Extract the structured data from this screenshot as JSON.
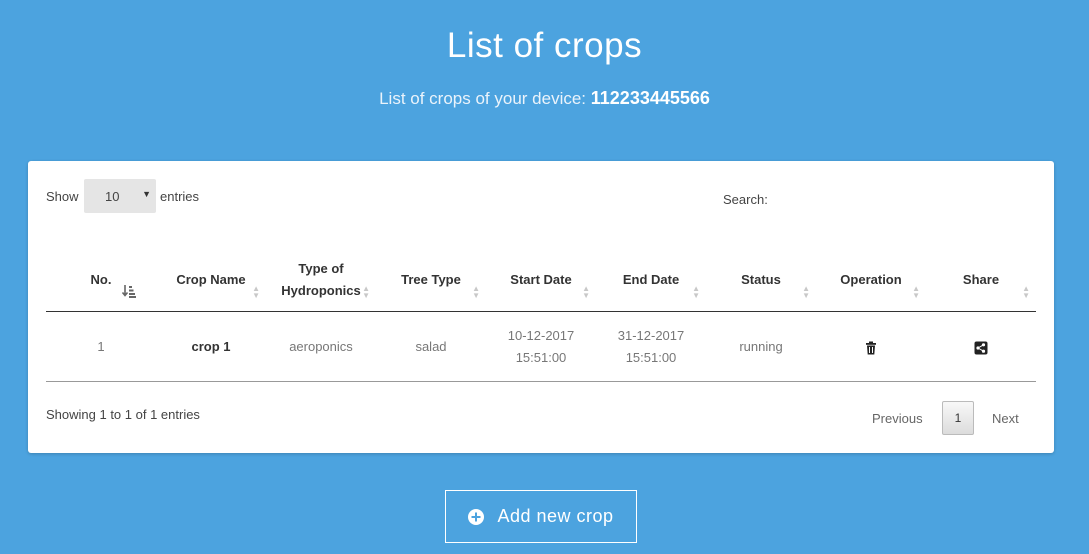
{
  "header": {
    "title": "List of crops",
    "subtitle_prefix": "List of crops of your device:",
    "device_id": "112233445566"
  },
  "controls": {
    "show_label": "Show",
    "entries_value": "10",
    "entries_label": "entries",
    "search_label": "Search:",
    "search_value": ""
  },
  "table": {
    "columns": [
      "No.",
      "Crop Name",
      "Type of Hydroponics",
      "Tree Type",
      "Start Date",
      "End Date",
      "Status",
      "Operation",
      "Share"
    ],
    "rows": [
      {
        "no": "1",
        "crop_name": "crop 1",
        "hydroponics_type": "aeroponics",
        "tree_type": "salad",
        "start_date": "10-12-2017 15:51:00",
        "end_date": "31-12-2017 15:51:00",
        "status": "running",
        "operation_icon": "trash-icon",
        "share_icon": "share-icon"
      }
    ]
  },
  "footer": {
    "showing_text": "Showing 1 to 1 of 1 entries",
    "previous_label": "Previous",
    "current_page": "1",
    "next_label": "Next"
  },
  "actions": {
    "add_label": "Add new crop",
    "add_icon": "plus-circle-icon"
  },
  "colors": {
    "background": "#4ca3df",
    "card": "#ffffff",
    "text": "#333333"
  }
}
